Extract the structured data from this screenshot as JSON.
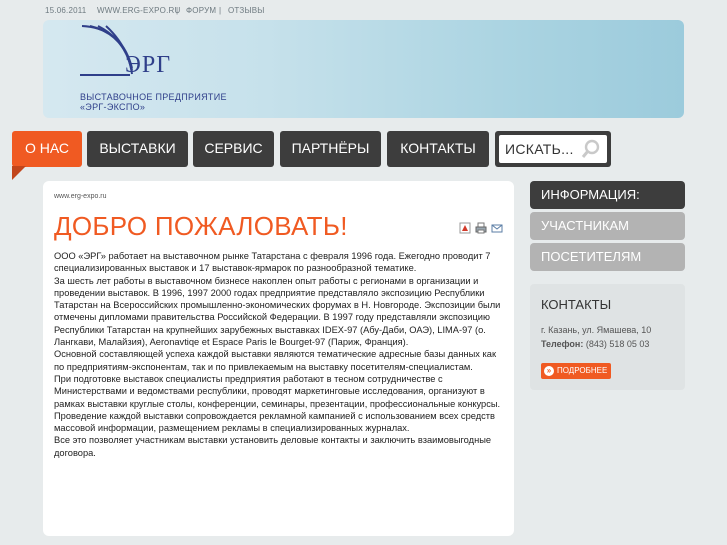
{
  "topbar": {
    "date": "15.06.2011",
    "site": "WWW.ERG-EXPO.RU",
    "sep1": "|",
    "forum": "ФОРУМ",
    "sep2": "|",
    "reviews": "ОТЗЫВЫ"
  },
  "logo": {
    "mark": "ЭРГ",
    "line1": "ВЫСТАВОЧНОЕ ПРЕДПРИЯТИЕ",
    "line2": "«ЭРГ-ЭКСПО»"
  },
  "nav": [
    "О НАС",
    "ВЫСТАВКИ",
    "СЕРВИС",
    "ПАРТНЁРЫ",
    "КОНТАКТЫ"
  ],
  "search": {
    "placeholder": "ИСКАТЬ..."
  },
  "content": {
    "breadcrumb": "www.erg-expo.ru",
    "title": "ДОБРО ПОЖАЛОВАТЬ!",
    "paragraphs": [
      "ООО «ЭРГ» работает на выставочном рынке Татарстана с февраля 1996 года. Ежегодно проводит 7 специализированных выставок и 17 выставок-ярмарок по разнообразной тематике.",
      "За шесть лет работы в выставочном бизнесе накоплен опыт работы с регионами в организации и проведении выставок. В   1996,   1997  2000 годах предприятие представляло экспозицию Республики Татарстан на Всероссийских промышленно-экономических форумах в Н. Новгороде. Экспозиции были отмечены дипломами правительства Российской Федерации. В   1997 году представляли экспозицию Республики Татарстан на крупнейших зарубежных выставках  IDEX-97 (Абу-Даби, ОАЭ), LIMA-97 (о. Лангкави, Малайзия), Aeronavtiqe et Espace Paris le Bourget-97 (Париж, Франция).",
      "Основной составляющей успеха каждой выставки являются тематические адресные базы данных как по предприятиям-экспонентам, так и по привлекаемым на выставку посетителям-специалистам.",
      "При подготовке выставок специалисты предприятия работают в тесном сотрудничестве с Министерствами и ведомствами республики, проводят маркетинговые исследования, организуют в рамках выставки круглые столы, конференции, семинары, презентации, профессиональные конкурсы.",
      "Проведение каждой выставки сопровождается рекламной кампанией с использованием всех средств массовой информации, размещением рекламы в специализированных журналах.",
      "Все это позволяет участникам выставки установить деловые контакты и заключить взаимовыгодные договора."
    ]
  },
  "sidebar": {
    "items": [
      "ИНФОРМАЦИЯ:",
      "УЧАСТНИКАМ",
      "ПОСЕТИТЕЛЯМ"
    ]
  },
  "contacts": {
    "title": "КОНТАКТЫ",
    "address": "г. Казань, ул. Ямашева, 10",
    "phone_label": "Телефон:",
    "phone": "(843) 518 05 03",
    "more": "ПОДРОБНЕЕ"
  },
  "colors": {
    "accent": "#f05a22",
    "nav_bg": "#3d3d3d",
    "side_info": "#3d3d3d",
    "side_item": "#b3b3b3",
    "logo_blue": "#2f3f8a"
  }
}
